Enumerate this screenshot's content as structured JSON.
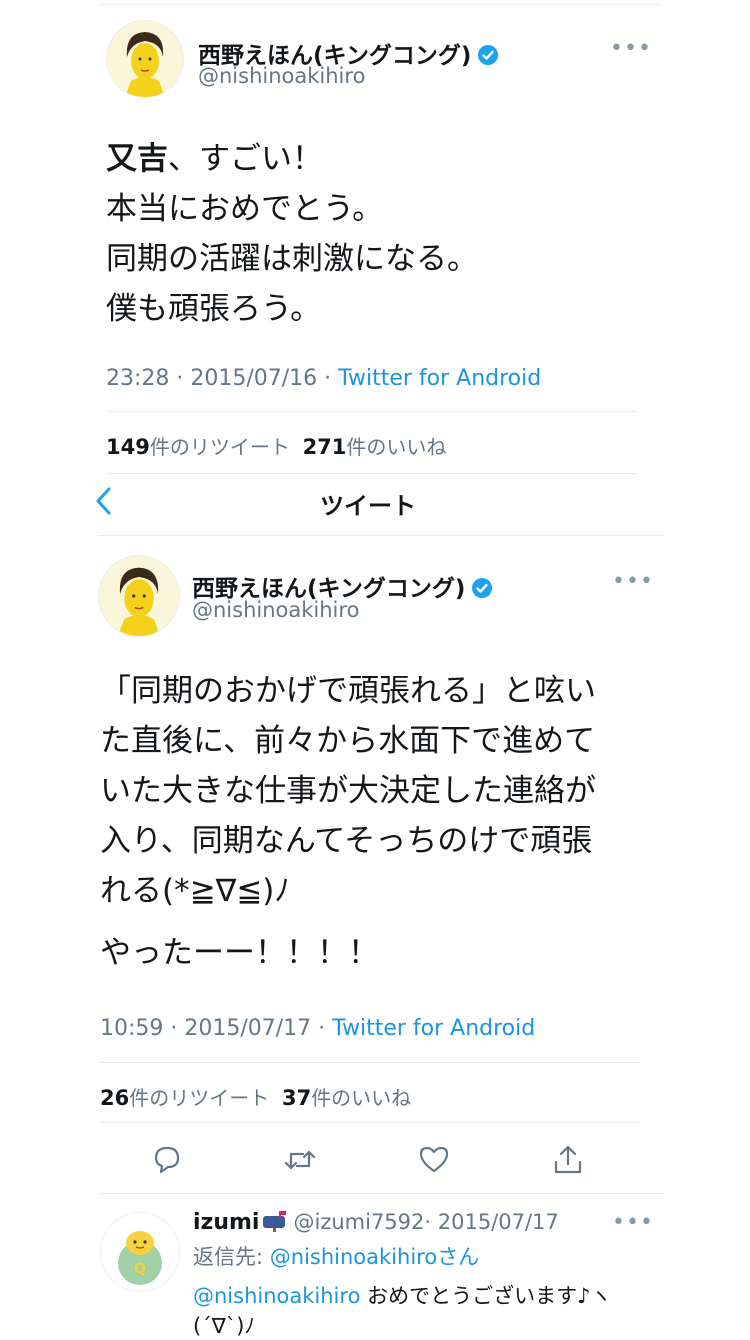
{
  "tweet1": {
    "name": "西野えほん(キングコング)",
    "handle": "@nishinoakihiro",
    "body_bold": "又吉",
    "body_rest": "、すごい！\n本当におめでとう。\n同期の活躍は刺激になる。\n僕も頑張ろう。",
    "time": "23:28 · 2015/07/16 · ",
    "source": "Twitter for Android",
    "retweet_count": "149",
    "retweet_label": "件のリツイート",
    "like_count": "271",
    "like_label": "件のいいね"
  },
  "nav": {
    "title": "ツイート"
  },
  "tweet2": {
    "name": "西野えほん(キングコング)",
    "handle": "@nishinoakihiro",
    "body": "「同期のおかげで頑張れる」と呟い\nた直後に、前々から水面下で進めて\nいた大きな仕事が大決定した連絡が\n入り、同期なんてそっちのけで頑張\nれる(*≧∇≦)ﾉ",
    "body2": "やったーー！！！！",
    "time": "10:59 · 2015/07/17 · ",
    "source": "Twitter for Android",
    "retweet_count": "26",
    "retweet_label": "件のリツイート",
    "like_count": "37",
    "like_label": "件のいいね"
  },
  "actions": {
    "reply": "reply-icon",
    "retweet": "retweet-icon",
    "like": "heart-icon",
    "share": "share-icon"
  },
  "reply": {
    "name": "izumi",
    "name_icon": "mailbox-icon",
    "handle": "@izumi7592",
    "date": "· 2015/07/17",
    "reply_to_label": "返信先: ",
    "reply_to_handle": "@nishinoakihiro",
    "reply_to_suffix": "さん",
    "mention": "@nishinoakihiro",
    "text": " おめでとうございます♪ヽ",
    "text2": "(´∇`)ﾉ"
  },
  "colors": {
    "link": "#1b95e0",
    "verified": "#1da1f2",
    "secondary": "#657786"
  }
}
